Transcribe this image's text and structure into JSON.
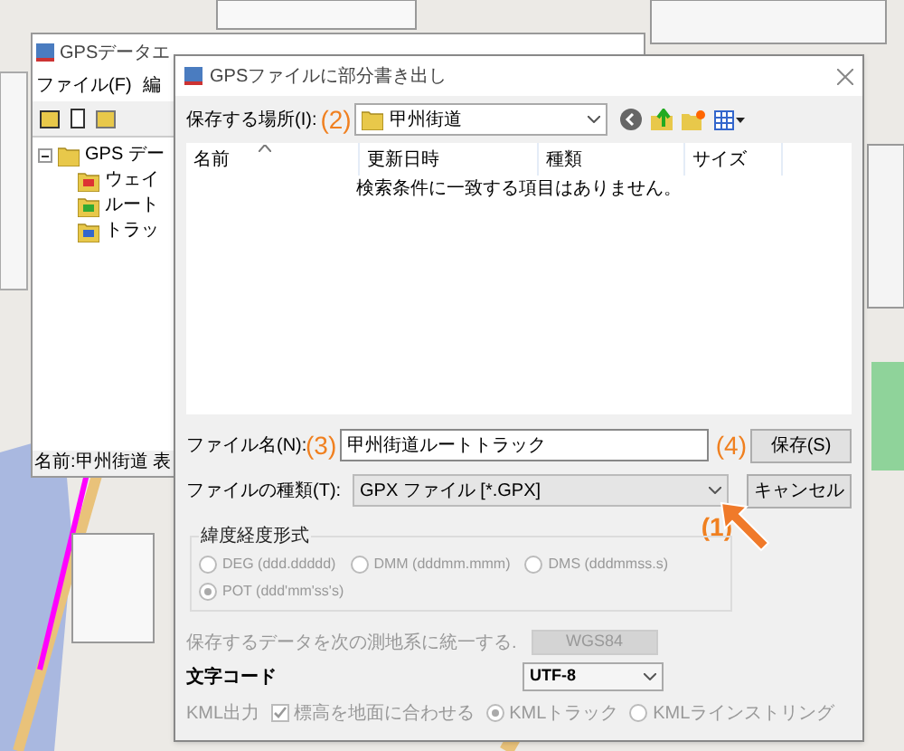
{
  "main_window": {
    "title": "GPSデータエ",
    "menu": [
      "ファイル(F)",
      "編"
    ],
    "tree": [
      {
        "label": "GPS デー",
        "expanded": true,
        "children": [
          {
            "label": "ウェイ",
            "kind": "waypoint"
          },
          {
            "label": "ルート",
            "kind": "route"
          },
          {
            "label": "トラッ",
            "kind": "track"
          }
        ]
      }
    ],
    "status": "名前:甲州街道 表"
  },
  "dialog": {
    "title": "GPSファイルに部分書き出し",
    "location_label": "保存する場所(I):",
    "location_marker": "(2)",
    "location": "甲州街道",
    "columns": [
      {
        "label": "名前",
        "sorted": true
      },
      {
        "label": "更新日時",
        "sorted": false
      },
      {
        "label": "種類",
        "sorted": false
      },
      {
        "label": "サイズ",
        "sorted": false
      }
    ],
    "empty_message": "検索条件に一致する項目はありません。",
    "file_name_label": "ファイル名(N):",
    "file_name_marker": "(3)",
    "file_name": "甲州街道ルートトラック",
    "save_marker": "(4)",
    "file_type_label": "ファイルの種類(T):",
    "file_type": "GPX ファイル [*.GPX]",
    "file_type_marker": "(1)",
    "buttons": [
      {
        "label": "保存(S)"
      },
      {
        "label": "キャンセル"
      }
    ],
    "coord_format": {
      "title": "緯度経度形式",
      "disabled": true,
      "options": [
        {
          "label": "DEG (ddd.ddddd)",
          "selected": false
        },
        {
          "label": "DMM (dddmm.mmm)",
          "selected": false
        },
        {
          "label": "DMS (dddmmss.s)",
          "selected": false
        },
        {
          "label": "POT (ddd'mm'ss's)",
          "selected": true
        }
      ]
    },
    "datum_label": "保存するデータを次の測地系に統一する.",
    "datum_disabled": true,
    "datum": "WGS84",
    "encoding_label": "文字コード",
    "encoding": "UTF-8",
    "kml": {
      "label": "KML出力",
      "disabled": true,
      "ground_label": "標高を地面に合わせる",
      "ground_checked": true,
      "modes": [
        {
          "label": "KMLトラック",
          "selected": true
        },
        {
          "label": "KMLラインストリング",
          "selected": false
        }
      ]
    }
  }
}
